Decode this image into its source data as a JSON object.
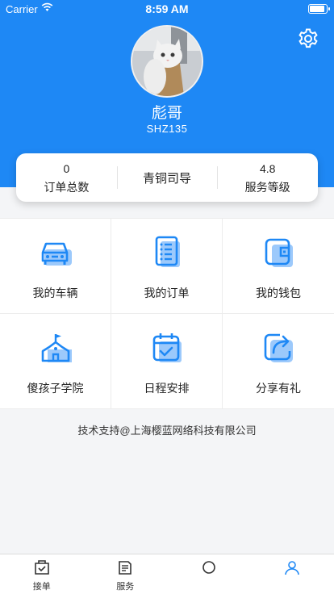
{
  "status_bar": {
    "carrier": "Carrier",
    "time": "8:59 AM"
  },
  "colors": {
    "primary": "#1e88f5",
    "icon_shadow": "#9cc9fb"
  },
  "profile": {
    "name": "彪哥",
    "id": "SHZ135"
  },
  "stats": {
    "orders": {
      "value": "0",
      "label": "订单总数"
    },
    "rank": {
      "label": "青铜司导"
    },
    "rating": {
      "value": "4.8",
      "label": "服务等级"
    }
  },
  "menu": [
    {
      "label": "我的车辆",
      "icon": "car-icon"
    },
    {
      "label": "我的订单",
      "icon": "order-list-icon"
    },
    {
      "label": "我的钱包",
      "icon": "wallet-icon"
    },
    {
      "label": "傻孩子学院",
      "icon": "school-icon"
    },
    {
      "label": "日程安排",
      "icon": "calendar-icon"
    },
    {
      "label": "分享有礼",
      "icon": "share-icon"
    }
  ],
  "footer": "技术支持@上海樱蓝网络科技有限公司",
  "tabs": [
    {
      "label": "接单",
      "icon": "accept-order-icon"
    },
    {
      "label": "服务",
      "icon": "service-icon"
    },
    {
      "label": "",
      "icon": "tab-icon"
    },
    {
      "label": "",
      "icon": "tab-icon"
    }
  ]
}
